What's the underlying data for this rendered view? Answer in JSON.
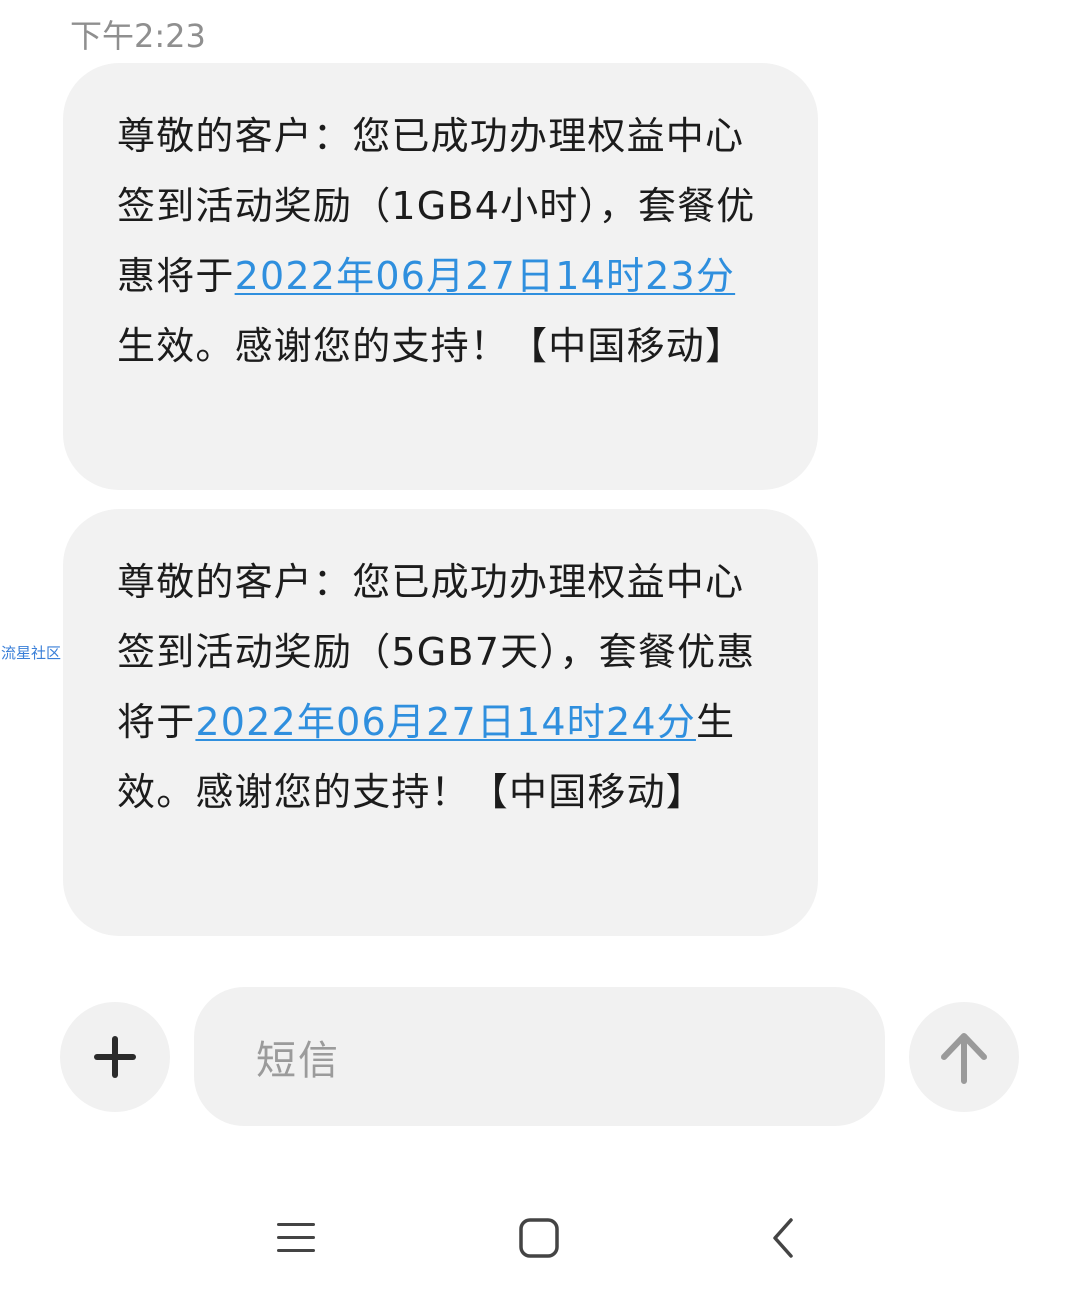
{
  "conversation": {
    "timestamp": "下午2:23",
    "messages": [
      {
        "prefix": "尊敬的客户：您已成功办理权益中心签到活动奖励（1GB4小时），套餐优惠将于",
        "date_link": "2022年06月27日14时23分",
        "suffix": "生效。感谢您的支持！【中国移动】"
      },
      {
        "prefix": "尊敬的客户：您已成功办理权益中心签到活动奖励（5GB7天），套餐优惠将于",
        "date_link": "2022年06月27日14时24分",
        "suffix": "生效。感谢您的支持！【中国移动】"
      }
    ]
  },
  "watermark": "流星社区",
  "composer": {
    "placeholder": "短信",
    "add_icon": "plus-icon",
    "send_icon": "arrow-up-icon"
  },
  "navbar": {
    "menu_icon": "menu-lines-icon",
    "home_icon": "home-square-icon",
    "back_icon": "back-chevron-icon"
  },
  "colors": {
    "link": "#2f8fde",
    "bubble": "#f2f2f2",
    "button_bg": "#f1f1f1",
    "icon_dark": "#2b2b2b",
    "icon_gray": "#9a9a9a"
  }
}
